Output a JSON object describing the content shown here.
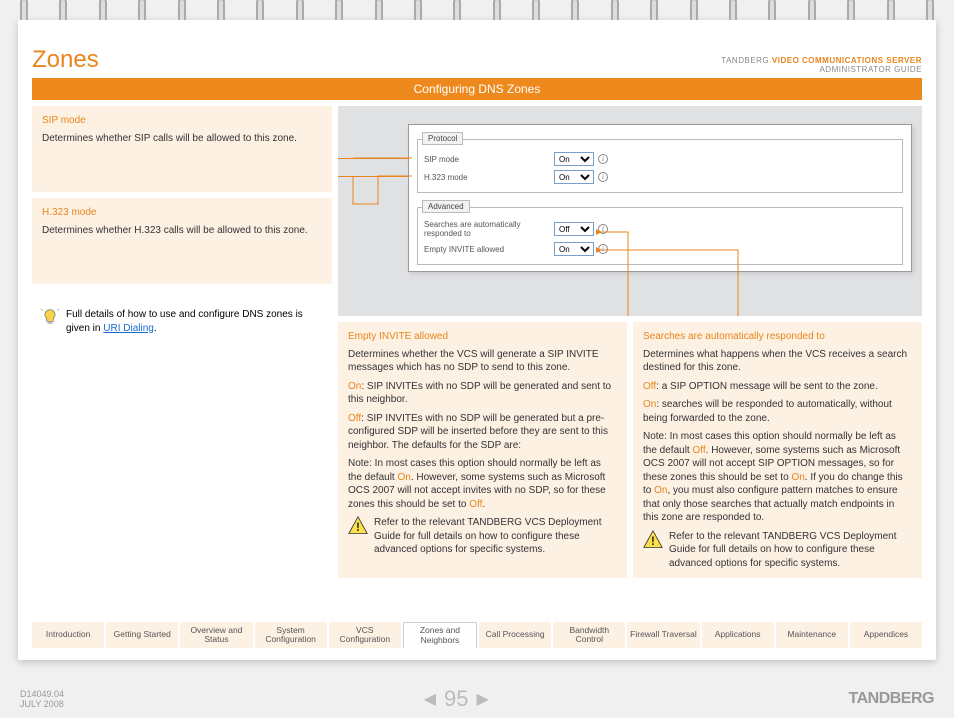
{
  "header": {
    "title": "Zones",
    "brand": "TANDBERG",
    "product": "VIDEO COMMUNICATIONS SERVER",
    "subtitle": "ADMINISTRATOR GUIDE"
  },
  "section_bar": "Configuring DNS Zones",
  "left": {
    "sip": {
      "title": "SIP mode",
      "body": "Determines whether SIP calls will be allowed to this zone."
    },
    "h323": {
      "title": "H.323 mode",
      "body": "Determines whether H.323 calls will be allowed to this zone."
    },
    "tip": {
      "pre": "Full details of how to use and configure DNS zones is given in ",
      "link": "URI Dialing",
      "post": "."
    }
  },
  "screenshot": {
    "fs1": {
      "legend": "Protocol",
      "rows": [
        {
          "label": "SIP mode",
          "value": "On"
        },
        {
          "label": "H.323 mode",
          "value": "On"
        }
      ]
    },
    "fs2": {
      "legend": "Advanced",
      "rows": [
        {
          "label": "Searches are automatically responded to",
          "value": "Off"
        },
        {
          "label": "Empty INVITE allowed",
          "value": "On"
        }
      ]
    }
  },
  "lower": {
    "empty": {
      "title": "Empty INVITE allowed",
      "p1": "Determines whether the VCS will generate a SIP INVITE messages which has no SDP to send to this zone.",
      "on_label": "On",
      "on_text": ": SIP INVITEs with no SDP will be generated and sent to this neighbor.",
      "off_label": "Off",
      "off_text": ": SIP INVITEs with no SDP will be generated but a pre-configured SDP will be inserted before they are sent to this neighbor.  The defaults for the SDP are:",
      "note_pre": "Note: In most cases this option should normally be left as the default ",
      "note_on": "On",
      "note_mid": ".  However, some systems such as Microsoft OCS 2007 will not accept invites with no SDP, so for these zones this should be set to ",
      "note_off": "Off",
      "note_post": ".",
      "warn": "Refer to the relevant TANDBERG VCS Deployment Guide for full details on how to configure these advanced options for specific systems."
    },
    "search": {
      "title": "Searches are automatically responded to",
      "p1": "Determines what happens when the VCS receives a search destined for this zone.",
      "off_label": "Off",
      "off_text": ": a SIP OPTION message will be sent to the zone.",
      "on_label": "On",
      "on_text": ": searches will be responded to automatically, without being forwarded to the zone.",
      "note_pre": "Note: In most cases this option should normally be left as the default ",
      "note_off": "Off",
      "note_mid": ". However, some systems such as Microsoft OCS 2007 will not accept SIP OPTION messages, so for these zones this should be set to ",
      "note_on": "On",
      "note_mid2": ". If you do change this to ",
      "note_on2": "On",
      "note_post": ", you must also configure pattern matches to ensure that only those searches that actually match endpoints in this zone are responded to.",
      "warn": "Refer to the relevant TANDBERG VCS Deployment Guide for full details on how to configure these advanced options for specific systems."
    }
  },
  "tabs": [
    "Introduction",
    "Getting Started",
    "Overview and Status",
    "System Configuration",
    "VCS Configuration",
    "Zones and Neighbors",
    "Call Processing",
    "Bandwidth Control",
    "Firewall Traversal",
    "Applications",
    "Maintenance",
    "Appendices"
  ],
  "active_tab": 5,
  "footer": {
    "doc": "D14049.04",
    "date": "JULY 2008",
    "page": "95",
    "brand": "TANDBERG"
  }
}
